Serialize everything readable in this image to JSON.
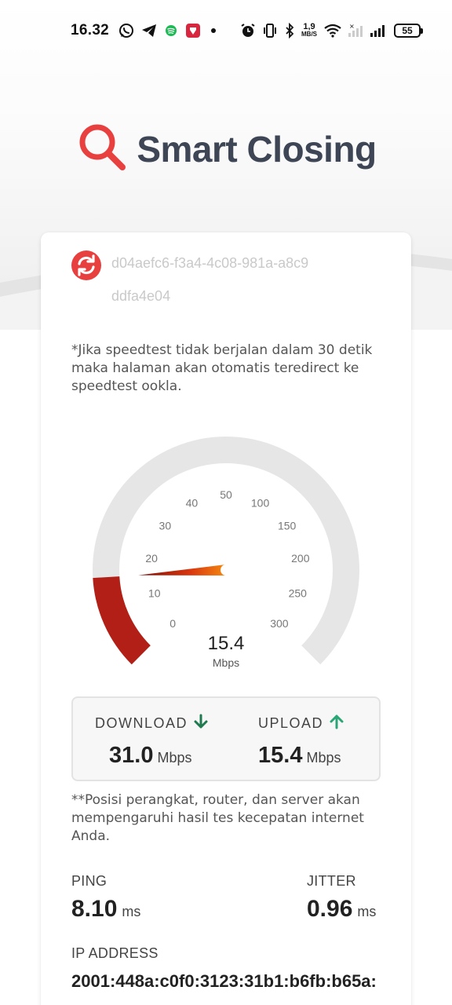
{
  "status_bar": {
    "time": "16.32",
    "net_speed_value": "1,9",
    "net_speed_unit": "MB/S",
    "battery": "55",
    "icons": [
      "whatsapp-icon",
      "telegram-icon",
      "spotify-icon",
      "app-shield-icon",
      "dot-icon",
      "alarm-icon",
      "vibrate-icon",
      "bluetooth-icon",
      "wifi-icon",
      "signal-icon",
      "battery-icon"
    ]
  },
  "header": {
    "title": "Smart Closing",
    "icon": "magnifier-icon",
    "accent_color": "#e8403f"
  },
  "session": {
    "id": "d04aefc6-f3a4-4c08-981a-a8c9ddfa4e04",
    "icon": "sync-refresh-icon"
  },
  "notes": {
    "redirect": "*Jika speedtest tidak berjalan dalam 30 detik maka halaman akan otomatis teredirect ke speedtest ookla.",
    "position": "**Posisi perangkat, router, dan server akan mempengaruhi hasil tes kecepatan internet Anda."
  },
  "gauge": {
    "current_value": "15.4",
    "current_value_num": 15.4,
    "unit": "Mbps",
    "ticks": [
      "0",
      "10",
      "20",
      "30",
      "40",
      "50",
      "100",
      "150",
      "200",
      "250",
      "300"
    ],
    "fill_color": "#b11f16",
    "track_color": "#e6e6e6"
  },
  "results": {
    "download": {
      "label": "DOWNLOAD",
      "value": "31.0",
      "unit": "Mbps",
      "icon": "arrow-down-icon",
      "color": "#1f7a4f"
    },
    "upload": {
      "label": "UPLOAD",
      "value": "15.4",
      "unit": "Mbps",
      "icon": "arrow-up-icon",
      "color": "#2aa676"
    }
  },
  "metrics": {
    "ping": {
      "label": "PING",
      "value": "8.10",
      "unit": "ms"
    },
    "jitter": {
      "label": "JITTER",
      "value": "0.96",
      "unit": "ms"
    },
    "ip": {
      "label": "IP ADDRESS",
      "value": "2001:448a:c0f0:3123:31b1:b6fb:b65a:"
    }
  }
}
